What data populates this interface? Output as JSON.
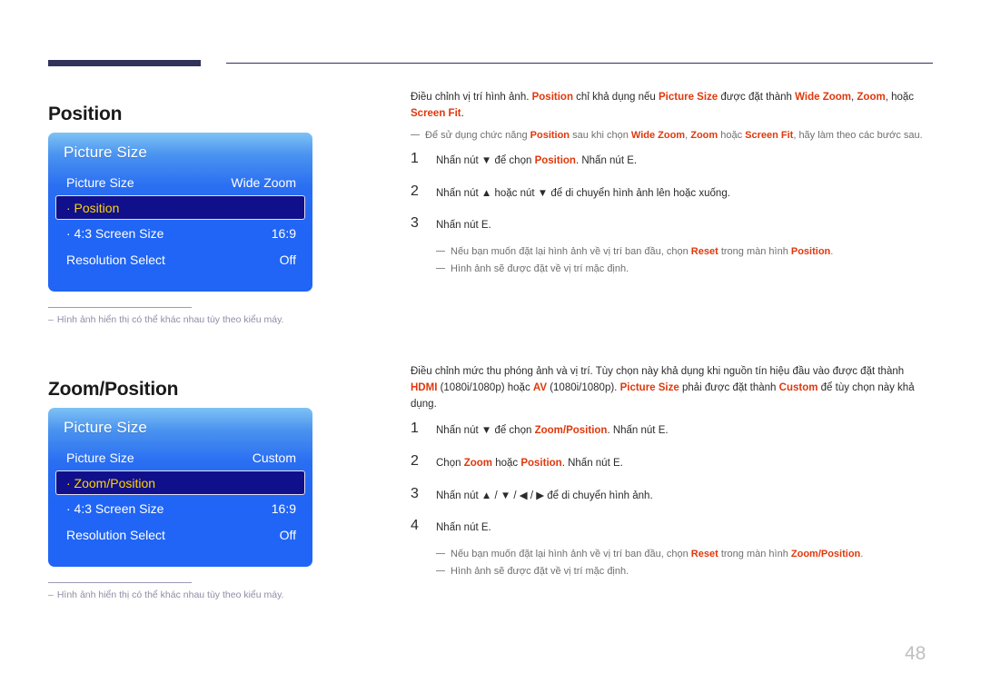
{
  "page": {
    "number": "48"
  },
  "sections": [
    {
      "heading": "Position",
      "osd": {
        "title": "Picture Size",
        "rows": [
          {
            "label": "Picture Size",
            "value": "Wide Zoom",
            "selected": false
          },
          {
            "label": "· Position",
            "value": "",
            "selected": true
          },
          {
            "label": "· 4:3 Screen Size",
            "value": "16:9",
            "selected": false
          },
          {
            "label": "Resolution Select",
            "value": "Off",
            "selected": false
          }
        ]
      },
      "caption": {
        "dash": "–",
        "text": "Hình ảnh hiển thị có thể khác nhau tùy theo kiểu máy."
      },
      "intro_parts": [
        {
          "t": "Điều chỉnh vị trí hình ảnh. ",
          "hl": false
        },
        {
          "t": "Position",
          "hl": true
        },
        {
          "t": " chỉ khả dụng nếu ",
          "hl": false
        },
        {
          "t": "Picture Size",
          "hl": true
        },
        {
          "t": " được đặt thành ",
          "hl": false
        },
        {
          "t": "Wide Zoom",
          "hl": true
        },
        {
          "t": ", ",
          "hl": false
        },
        {
          "t": "Zoom",
          "hl": true
        },
        {
          "t": ", hoặc ",
          "hl": false
        },
        {
          "t": "Screen Fit",
          "hl": true
        },
        {
          "t": ".",
          "hl": false
        }
      ],
      "intro_note_parts": [
        {
          "t": "Để sử dụng chức năng ",
          "hl": false
        },
        {
          "t": "Position",
          "hl": true
        },
        {
          "t": " sau khi chọn ",
          "hl": false
        },
        {
          "t": "Wide Zoom",
          "hl": true
        },
        {
          "t": ", ",
          "hl": false
        },
        {
          "t": "Zoom",
          "hl": true
        },
        {
          "t": " hoặc ",
          "hl": false
        },
        {
          "t": "Screen Fit",
          "hl": true
        },
        {
          "t": ", hãy làm theo các bước sau.",
          "hl": false
        }
      ],
      "steps": [
        {
          "num": "1",
          "parts": [
            {
              "t": "Nhấn nút ▼ để chọn ",
              "hl": false
            },
            {
              "t": "Position",
              "hl": true
            },
            {
              "t": ". Nhấn nút E.",
              "hl": false
            }
          ]
        },
        {
          "num": "2",
          "parts": [
            {
              "t": "Nhấn nút ▲ hoặc nút ▼ để di chuyển hình ảnh lên hoặc xuống.",
              "hl": false
            }
          ]
        },
        {
          "num": "3",
          "parts": [
            {
              "t": "Nhấn nút E.",
              "hl": false
            }
          ]
        }
      ],
      "end_notes": [
        [
          {
            "t": "Nếu bạn muốn đặt lại hình ảnh về vị trí ban đầu, chọn ",
            "hl": false
          },
          {
            "t": "Reset",
            "hl": true
          },
          {
            "t": " trong màn hình ",
            "hl": false
          },
          {
            "t": "Position",
            "hl": true
          },
          {
            "t": ".",
            "hl": false
          }
        ],
        [
          {
            "t": "Hình ảnh sẽ được đặt về vị trí mặc định.",
            "hl": false
          }
        ]
      ]
    },
    {
      "heading": "Zoom/Position",
      "osd": {
        "title": "Picture Size",
        "rows": [
          {
            "label": "Picture Size",
            "value": "Custom",
            "selected": false
          },
          {
            "label": "· Zoom/Position",
            "value": "",
            "selected": true
          },
          {
            "label": "· 4:3 Screen Size",
            "value": "16:9",
            "selected": false
          },
          {
            "label": "Resolution Select",
            "value": "Off",
            "selected": false
          }
        ]
      },
      "caption": {
        "dash": "–",
        "text": "Hình ảnh hiển thị có thể khác nhau tùy theo kiểu máy."
      },
      "intro_parts": [
        {
          "t": "Điều chỉnh mức thu phóng ảnh và vị trí. Tùy chọn này khả dụng khi nguồn tín hiệu đầu vào được đặt thành ",
          "hl": false
        },
        {
          "t": "HDMI",
          "hl": true
        },
        {
          "t": " (1080i/1080p) hoặc ",
          "hl": false
        },
        {
          "t": "AV",
          "hl": true
        },
        {
          "t": " (1080i/1080p). ",
          "hl": false
        },
        {
          "t": "Picture Size",
          "hl": true
        },
        {
          "t": " phải được đặt thành ",
          "hl": false
        },
        {
          "t": "Custom",
          "hl": true
        },
        {
          "t": " để tùy chọn này khả dụng.",
          "hl": false
        }
      ],
      "intro_note_parts": [],
      "steps": [
        {
          "num": "1",
          "parts": [
            {
              "t": "Nhấn nút ▼ để chọn ",
              "hl": false
            },
            {
              "t": "Zoom/Position",
              "hl": true
            },
            {
              "t": ". Nhấn nút E.",
              "hl": false
            }
          ]
        },
        {
          "num": "2",
          "parts": [
            {
              "t": "Chọn ",
              "hl": false
            },
            {
              "t": "Zoom",
              "hl": true
            },
            {
              "t": " hoặc ",
              "hl": false
            },
            {
              "t": "Position",
              "hl": true
            },
            {
              "t": ". Nhấn nút E.",
              "hl": false
            }
          ]
        },
        {
          "num": "3",
          "parts": [
            {
              "t": "Nhấn nút ▲ / ▼ / ◀ / ▶ để di chuyển hình ảnh.",
              "hl": false
            }
          ]
        },
        {
          "num": "4",
          "parts": [
            {
              "t": "Nhấn nút E.",
              "hl": false
            }
          ]
        }
      ],
      "end_notes": [
        [
          {
            "t": "Nếu bạn muốn đặt lại hình ảnh về vị trí ban đầu, chọn ",
            "hl": false
          },
          {
            "t": "Reset",
            "hl": true
          },
          {
            "t": " trong màn hình ",
            "hl": false
          },
          {
            "t": "Zoom/Position",
            "hl": true
          },
          {
            "t": ".",
            "hl": false
          }
        ],
        [
          {
            "t": "Hình ảnh sẽ được đặt về vị trí mặc định.",
            "hl": false
          }
        ]
      ]
    }
  ],
  "colors": {
    "highlight": "#e0380c",
    "rule": "#32325a",
    "osd_selected_bg": "#10108c",
    "osd_selected_text": "#ffd400",
    "page_number": "#bfbfbf"
  }
}
